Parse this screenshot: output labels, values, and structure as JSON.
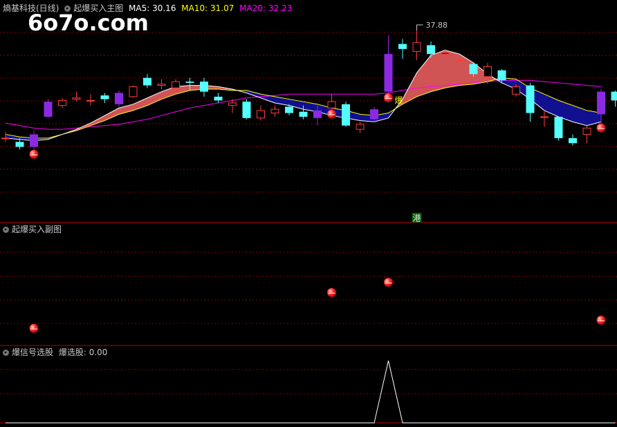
{
  "header_main": {
    "stock": "熵基科技(日线)",
    "indicator": "起爆买入主图",
    "ma5_label": "MA5: 30.16",
    "ma10_label": "MA10: 31.07",
    "ma20_label": "MA20: 32.23"
  },
  "header_sub": {
    "title": "起爆买入副图"
  },
  "header_sel": {
    "title": "爆信号选股",
    "value_label": "爆选股: 0.00"
  },
  "watermark": "6o7o.com",
  "annotations": {
    "peak_label": "37.88",
    "bao": "爆",
    "gang": "港"
  },
  "colors": {
    "up": "#ff3b3b",
    "down": "#54ffff",
    "signal": "#8a2be2",
    "ma5": "#ffffff",
    "ma10": "#ffff00",
    "ma20": "#ff00ff",
    "bull_fill": "#d05454",
    "bear_fill": "#101090",
    "grid": "#8b0000"
  },
  "chart_data": [
    {
      "type": "candlestick",
      "name": "main",
      "ylim": [
        22.8,
        39.2
      ],
      "series": [
        {
          "name": "MA5",
          "values": [
            29.3,
            29.2,
            29.1,
            29.2,
            29.6,
            30.0,
            30.5,
            31.1,
            31.7,
            32.0,
            32.5,
            33.0,
            33.4,
            33.5,
            33.5,
            33.4,
            33.2,
            32.9,
            32.5,
            32.1,
            31.9,
            31.6,
            31.4,
            31.1,
            30.9,
            30.7,
            30.6,
            30.9,
            32.4,
            34.5,
            35.9,
            36.3,
            36.0,
            35.3,
            34.4,
            33.7,
            33.2,
            32.4,
            31.5,
            31.0,
            30.6,
            30.3,
            30.6
          ]
        },
        {
          "name": "MA10",
          "values": [
            29.6,
            29.4,
            29.3,
            29.3,
            29.6,
            29.9,
            30.3,
            30.7,
            31.2,
            31.5,
            31.9,
            32.4,
            32.8,
            33.1,
            33.2,
            33.2,
            33.1,
            33.1,
            32.8,
            32.6,
            32.4,
            32.2,
            32.0,
            31.7,
            31.5,
            31.2,
            31.1,
            31.3,
            32.0,
            32.6,
            33.0,
            33.3,
            33.5,
            33.6,
            33.8,
            34.1,
            34.0,
            33.3,
            32.8,
            32.3,
            31.9,
            31.5,
            31.3
          ]
        },
        {
          "name": "MA20",
          "values": [
            30.5,
            30.3,
            30.1,
            30.0,
            30.0,
            30.1,
            30.2,
            30.3,
            30.4,
            30.6,
            30.8,
            31.1,
            31.4,
            31.7,
            31.9,
            32.1,
            32.3,
            32.5,
            32.6,
            32.7,
            32.8,
            32.8,
            32.8,
            32.8,
            32.8,
            32.8,
            32.8,
            32.9,
            33.1,
            33.3,
            33.4,
            33.5,
            33.6,
            33.7,
            33.8,
            33.9,
            33.9,
            33.9,
            33.8,
            33.7,
            33.6,
            33.5,
            33.4
          ]
        }
      ],
      "candles": [
        {
          "o": 29.3,
          "c": 29.3,
          "h": 29.8,
          "l": 29.0
        },
        {
          "o": 29.0,
          "c": 28.6,
          "h": 29.3,
          "l": 28.4
        },
        {
          "o": 28.6,
          "c": 29.6,
          "h": 29.9,
          "l": 28.4,
          "sig": true
        },
        {
          "o": 31.0,
          "c": 32.2,
          "h": 32.4,
          "l": 30.9,
          "sig": true
        },
        {
          "o": 31.9,
          "c": 32.3,
          "h": 32.5,
          "l": 31.7
        },
        {
          "o": 32.4,
          "c": 32.5,
          "h": 33.0,
          "l": 32.2
        },
        {
          "o": 32.3,
          "c": 32.3,
          "h": 32.8,
          "l": 31.9
        },
        {
          "o": 32.7,
          "c": 32.4,
          "h": 32.9,
          "l": 32.1
        },
        {
          "o": 32.0,
          "c": 32.9,
          "h": 33.1,
          "l": 31.8,
          "sig": true
        },
        {
          "o": 32.6,
          "c": 33.4,
          "h": 33.5,
          "l": 32.5
        },
        {
          "o": 34.1,
          "c": 33.5,
          "h": 34.4,
          "l": 33.3
        },
        {
          "o": 33.5,
          "c": 33.6,
          "h": 34.0,
          "l": 33.2
        },
        {
          "o": 33.3,
          "c": 33.8,
          "h": 34.0,
          "l": 33.1
        },
        {
          "o": 33.8,
          "c": 33.7,
          "h": 34.1,
          "l": 33.1
        },
        {
          "o": 33.8,
          "c": 33.0,
          "h": 34.1,
          "l": 32.6
        },
        {
          "o": 32.6,
          "c": 32.3,
          "h": 32.9,
          "l": 32.1
        },
        {
          "o": 31.9,
          "c": 32.1,
          "h": 32.4,
          "l": 31.3
        },
        {
          "o": 32.2,
          "c": 30.9,
          "h": 32.4,
          "l": 30.8
        },
        {
          "o": 30.9,
          "c": 31.5,
          "h": 31.9,
          "l": 30.7
        },
        {
          "o": 31.3,
          "c": 31.6,
          "h": 31.9,
          "l": 31.0
        },
        {
          "o": 31.8,
          "c": 31.3,
          "h": 32.0,
          "l": 31.1
        },
        {
          "o": 31.4,
          "c": 31.0,
          "h": 31.9,
          "l": 30.8
        },
        {
          "o": 30.9,
          "c": 31.5,
          "h": 31.9,
          "l": 30.3,
          "sig": true
        },
        {
          "o": 31.7,
          "c": 32.2,
          "h": 32.8,
          "l": 31.6
        },
        {
          "o": 32.0,
          "c": 30.3,
          "h": 32.2,
          "l": 30.2
        },
        {
          "o": 30.0,
          "c": 30.4,
          "h": 30.6,
          "l": 29.7
        },
        {
          "o": 30.8,
          "c": 31.6,
          "h": 31.8,
          "l": 30.6,
          "sig": true
        },
        {
          "o": 33.0,
          "c": 36.0,
          "h": 37.5,
          "l": 32.9,
          "sig": true
        },
        {
          "o": 36.8,
          "c": 36.4,
          "h": 37.2,
          "l": 35.6
        },
        {
          "o": 36.2,
          "c": 36.9,
          "h": 37.88,
          "l": 35.5
        },
        {
          "o": 36.7,
          "c": 36.0,
          "h": 37.0,
          "l": 35.7
        },
        {
          "o": 36.0,
          "c": 36.1,
          "h": 36.4,
          "l": 35.9
        },
        {
          "o": 35.5,
          "c": 35.5,
          "h": 35.6,
          "l": 35.4
        },
        {
          "o": 35.2,
          "c": 34.4,
          "h": 35.3,
          "l": 34.2
        },
        {
          "o": 34.2,
          "c": 35.0,
          "h": 35.3,
          "l": 33.6
        },
        {
          "o": 34.7,
          "c": 33.9,
          "h": 34.8,
          "l": 33.7
        },
        {
          "o": 32.8,
          "c": 33.4,
          "h": 33.6,
          "l": 32.6
        },
        {
          "o": 33.5,
          "c": 31.3,
          "h": 33.7,
          "l": 30.6
        },
        {
          "o": 31.0,
          "c": 31.0,
          "h": 31.5,
          "l": 30.2
        },
        {
          "o": 31.0,
          "c": 29.3,
          "h": 31.0,
          "l": 29.1
        },
        {
          "o": 29.3,
          "c": 28.9,
          "h": 29.6,
          "l": 28.7
        },
        {
          "o": 29.6,
          "c": 30.1,
          "h": 30.3,
          "l": 28.9
        },
        {
          "o": 31.2,
          "c": 33.0,
          "h": 33.2,
          "l": 30.5,
          "sig": true
        },
        {
          "o": 33.0,
          "c": 32.3,
          "h": 33.1,
          "l": 31.8
        }
      ],
      "signal_balls": [
        2,
        23,
        27,
        42
      ]
    },
    {
      "type": "scatter",
      "name": "sub",
      "signals": [
        {
          "x": 2,
          "level": 0.1
        },
        {
          "x": 23,
          "level": 0.45
        },
        {
          "x": 27,
          "level": 0.55
        },
        {
          "x": 42,
          "level": 0.18
        }
      ]
    },
    {
      "type": "line",
      "name": "selector",
      "ylim": [
        0,
        1
      ],
      "values": [
        0,
        0,
        0,
        0,
        0,
        0,
        0,
        0,
        0,
        0,
        0,
        0,
        0,
        0,
        0,
        0,
        0,
        0,
        0,
        0,
        0,
        0,
        0,
        0,
        0,
        0,
        0,
        1,
        0,
        0,
        0,
        0,
        0,
        0,
        0,
        0,
        0,
        0,
        0,
        0,
        0,
        0,
        0,
        0
      ]
    }
  ]
}
